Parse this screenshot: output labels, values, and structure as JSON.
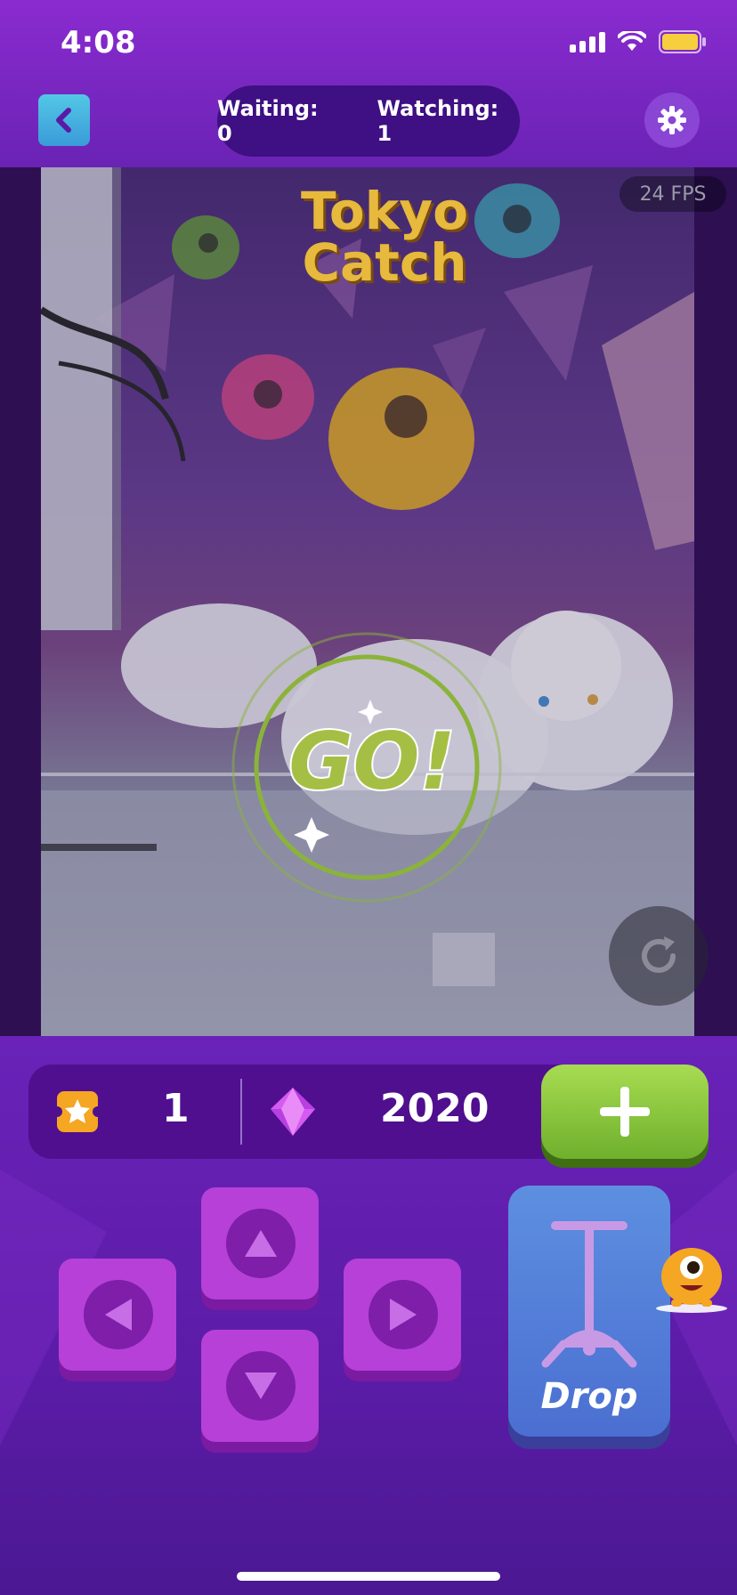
{
  "status_bar": {
    "time": "4:08"
  },
  "header": {
    "waiting_text": "Waiting: 0",
    "watching_text": "Watching: 1"
  },
  "video": {
    "fps": "24 FPS",
    "logo_line1": "Tokyo",
    "logo_line2": "Catch",
    "overlay_text": "GO!"
  },
  "wallet": {
    "tickets": "1",
    "gems": "2020"
  },
  "controls": {
    "drop_label": "Drop"
  },
  "colors": {
    "brand_purple": "#6a23b4",
    "add_green": "#8ccc3c",
    "drop_blue": "#4b6fd1",
    "dpad_magenta": "#b640d8"
  },
  "icons": {
    "back": "chevron-left-icon",
    "settings": "gear-icon",
    "refresh": "refresh-icon",
    "ticket": "star-ticket-icon",
    "gem": "gem-icon",
    "add": "plus-icon"
  }
}
